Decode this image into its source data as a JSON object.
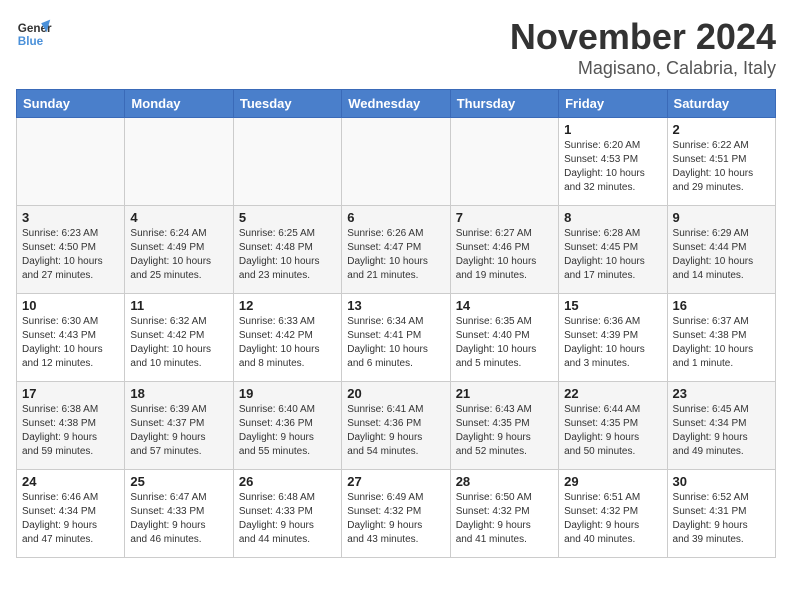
{
  "header": {
    "logo_line1": "General",
    "logo_line2": "Blue",
    "month": "November 2024",
    "location": "Magisano, Calabria, Italy"
  },
  "weekdays": [
    "Sunday",
    "Monday",
    "Tuesday",
    "Wednesday",
    "Thursday",
    "Friday",
    "Saturday"
  ],
  "weeks": [
    [
      {
        "day": "",
        "info": ""
      },
      {
        "day": "",
        "info": ""
      },
      {
        "day": "",
        "info": ""
      },
      {
        "day": "",
        "info": ""
      },
      {
        "day": "",
        "info": ""
      },
      {
        "day": "1",
        "info": "Sunrise: 6:20 AM\nSunset: 4:53 PM\nDaylight: 10 hours\nand 32 minutes."
      },
      {
        "day": "2",
        "info": "Sunrise: 6:22 AM\nSunset: 4:51 PM\nDaylight: 10 hours\nand 29 minutes."
      }
    ],
    [
      {
        "day": "3",
        "info": "Sunrise: 6:23 AM\nSunset: 4:50 PM\nDaylight: 10 hours\nand 27 minutes."
      },
      {
        "day": "4",
        "info": "Sunrise: 6:24 AM\nSunset: 4:49 PM\nDaylight: 10 hours\nand 25 minutes."
      },
      {
        "day": "5",
        "info": "Sunrise: 6:25 AM\nSunset: 4:48 PM\nDaylight: 10 hours\nand 23 minutes."
      },
      {
        "day": "6",
        "info": "Sunrise: 6:26 AM\nSunset: 4:47 PM\nDaylight: 10 hours\nand 21 minutes."
      },
      {
        "day": "7",
        "info": "Sunrise: 6:27 AM\nSunset: 4:46 PM\nDaylight: 10 hours\nand 19 minutes."
      },
      {
        "day": "8",
        "info": "Sunrise: 6:28 AM\nSunset: 4:45 PM\nDaylight: 10 hours\nand 17 minutes."
      },
      {
        "day": "9",
        "info": "Sunrise: 6:29 AM\nSunset: 4:44 PM\nDaylight: 10 hours\nand 14 minutes."
      }
    ],
    [
      {
        "day": "10",
        "info": "Sunrise: 6:30 AM\nSunset: 4:43 PM\nDaylight: 10 hours\nand 12 minutes."
      },
      {
        "day": "11",
        "info": "Sunrise: 6:32 AM\nSunset: 4:42 PM\nDaylight: 10 hours\nand 10 minutes."
      },
      {
        "day": "12",
        "info": "Sunrise: 6:33 AM\nSunset: 4:42 PM\nDaylight: 10 hours\nand 8 minutes."
      },
      {
        "day": "13",
        "info": "Sunrise: 6:34 AM\nSunset: 4:41 PM\nDaylight: 10 hours\nand 6 minutes."
      },
      {
        "day": "14",
        "info": "Sunrise: 6:35 AM\nSunset: 4:40 PM\nDaylight: 10 hours\nand 5 minutes."
      },
      {
        "day": "15",
        "info": "Sunrise: 6:36 AM\nSunset: 4:39 PM\nDaylight: 10 hours\nand 3 minutes."
      },
      {
        "day": "16",
        "info": "Sunrise: 6:37 AM\nSunset: 4:38 PM\nDaylight: 10 hours\nand 1 minute."
      }
    ],
    [
      {
        "day": "17",
        "info": "Sunrise: 6:38 AM\nSunset: 4:38 PM\nDaylight: 9 hours\nand 59 minutes."
      },
      {
        "day": "18",
        "info": "Sunrise: 6:39 AM\nSunset: 4:37 PM\nDaylight: 9 hours\nand 57 minutes."
      },
      {
        "day": "19",
        "info": "Sunrise: 6:40 AM\nSunset: 4:36 PM\nDaylight: 9 hours\nand 55 minutes."
      },
      {
        "day": "20",
        "info": "Sunrise: 6:41 AM\nSunset: 4:36 PM\nDaylight: 9 hours\nand 54 minutes."
      },
      {
        "day": "21",
        "info": "Sunrise: 6:43 AM\nSunset: 4:35 PM\nDaylight: 9 hours\nand 52 minutes."
      },
      {
        "day": "22",
        "info": "Sunrise: 6:44 AM\nSunset: 4:35 PM\nDaylight: 9 hours\nand 50 minutes."
      },
      {
        "day": "23",
        "info": "Sunrise: 6:45 AM\nSunset: 4:34 PM\nDaylight: 9 hours\nand 49 minutes."
      }
    ],
    [
      {
        "day": "24",
        "info": "Sunrise: 6:46 AM\nSunset: 4:34 PM\nDaylight: 9 hours\nand 47 minutes."
      },
      {
        "day": "25",
        "info": "Sunrise: 6:47 AM\nSunset: 4:33 PM\nDaylight: 9 hours\nand 46 minutes."
      },
      {
        "day": "26",
        "info": "Sunrise: 6:48 AM\nSunset: 4:33 PM\nDaylight: 9 hours\nand 44 minutes."
      },
      {
        "day": "27",
        "info": "Sunrise: 6:49 AM\nSunset: 4:32 PM\nDaylight: 9 hours\nand 43 minutes."
      },
      {
        "day": "28",
        "info": "Sunrise: 6:50 AM\nSunset: 4:32 PM\nDaylight: 9 hours\nand 41 minutes."
      },
      {
        "day": "29",
        "info": "Sunrise: 6:51 AM\nSunset: 4:32 PM\nDaylight: 9 hours\nand 40 minutes."
      },
      {
        "day": "30",
        "info": "Sunrise: 6:52 AM\nSunset: 4:31 PM\nDaylight: 9 hours\nand 39 minutes."
      }
    ]
  ]
}
